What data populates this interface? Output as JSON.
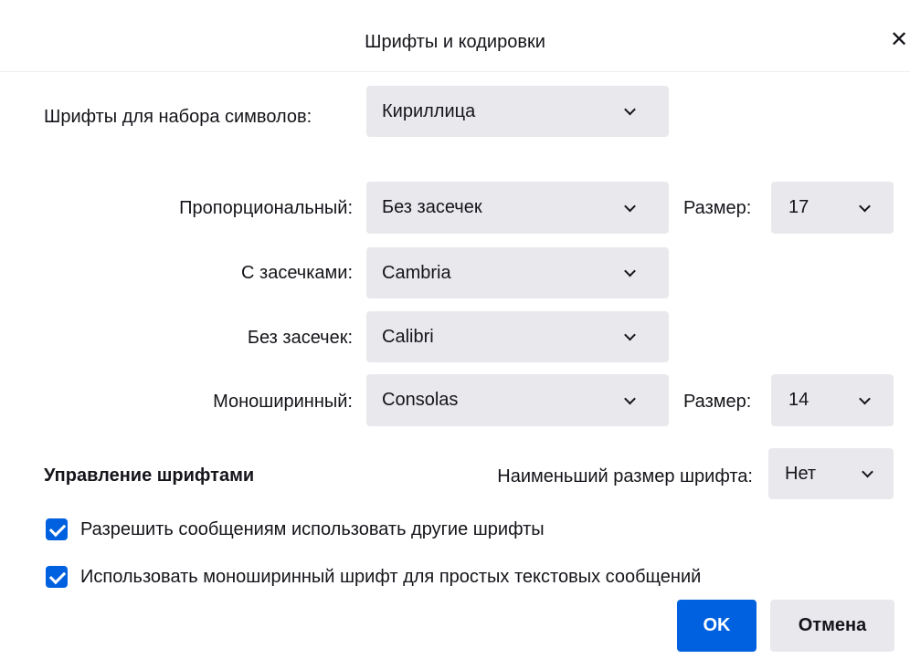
{
  "dialog": {
    "title": "Шрифты и кодировки",
    "close_glyph": "✕"
  },
  "charset": {
    "label": "Шрифты для набора символов:",
    "value": "Кириллица"
  },
  "proportional": {
    "label": "Пропорциональный:",
    "value": "Без засечек",
    "size_label": "Размер:",
    "size_value": "17"
  },
  "serif": {
    "label": "С засечками:",
    "value": "Cambria"
  },
  "sans_serif": {
    "label": "Без засечек:",
    "value": "Calibri"
  },
  "monospace": {
    "label": "Моноширинный:",
    "value": "Consolas",
    "size_label": "Размер:",
    "size_value": "14"
  },
  "font_control": {
    "heading": "Управление шрифтами",
    "min_size_label": "Наименьший размер шрифта:",
    "min_size_value": "Нет"
  },
  "options": {
    "allow_other_fonts": {
      "label": "Разрешить сообщениям использовать другие шрифты",
      "checked": true
    },
    "monospace_plain_text": {
      "label": "Использовать моноширинный шрифт для простых текстовых сообщений",
      "checked": true
    }
  },
  "buttons": {
    "ok": "OK",
    "cancel": "Отмена"
  },
  "colors": {
    "accent": "#0061e0",
    "select_bg": "#e9e9ed",
    "text": "#15141a"
  },
  "icons": {
    "close": "close-icon",
    "dropdown": "chevron-down-icon",
    "check": "checkmark-icon"
  }
}
